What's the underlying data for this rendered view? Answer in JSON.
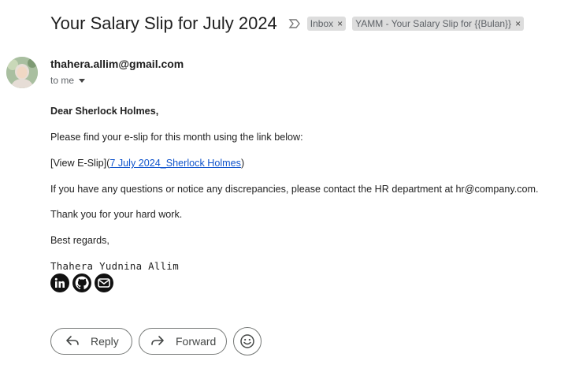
{
  "subject": "Your Salary Slip for July 2024",
  "labels": [
    {
      "text": "Inbox",
      "close": "×"
    },
    {
      "text": "YAMM - Your Salary Slip for {{Bulan}}",
      "close": "×"
    }
  ],
  "sender": {
    "email": "thahera.allim@gmail.com",
    "recipient_text": "to me"
  },
  "body": {
    "greeting": "Dear Sherlock Holmes,",
    "line1": "Please find your e-slip for this month using the link below:",
    "link_prefix": "[View E-Slip](",
    "link_text": "7 July 2024_Sherlock Holmes",
    "link_suffix": ")",
    "line3": "If you have any questions or notice any discrepancies, please contact the HR department at hr@company.com.",
    "line4": "Thank you for your hard work.",
    "line5": "Best regards,",
    "signature_name": "Thahera Yudnina Allim"
  },
  "social_icons": [
    "linkedin-icon",
    "github-icon",
    "email-icon"
  ],
  "actions": {
    "reply": "Reply",
    "forward": "Forward"
  },
  "colors": {
    "link": "#1155cc",
    "chip_bg": "#dddddd",
    "icon_bg": "#111111"
  }
}
